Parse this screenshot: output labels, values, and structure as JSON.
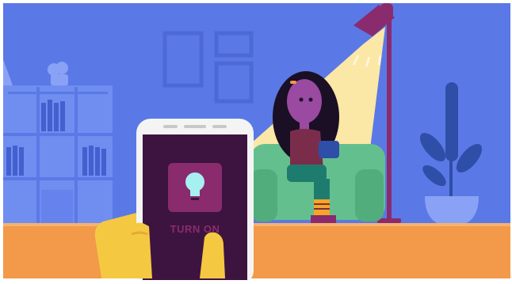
{
  "illustration": {
    "colors": {
      "wall": "#5a79e6",
      "floor": "#f2994a",
      "lamp_light": "#fbe7a6",
      "sofa": "#63c08e",
      "phone_screen": "#3d1440",
      "button_bg": "#8a2b6e",
      "hand": "#f5c842",
      "plant": "#2e4ea8"
    },
    "icons": [
      "lightbulb-icon"
    ]
  },
  "phone": {
    "button_label": "TURN ON"
  }
}
